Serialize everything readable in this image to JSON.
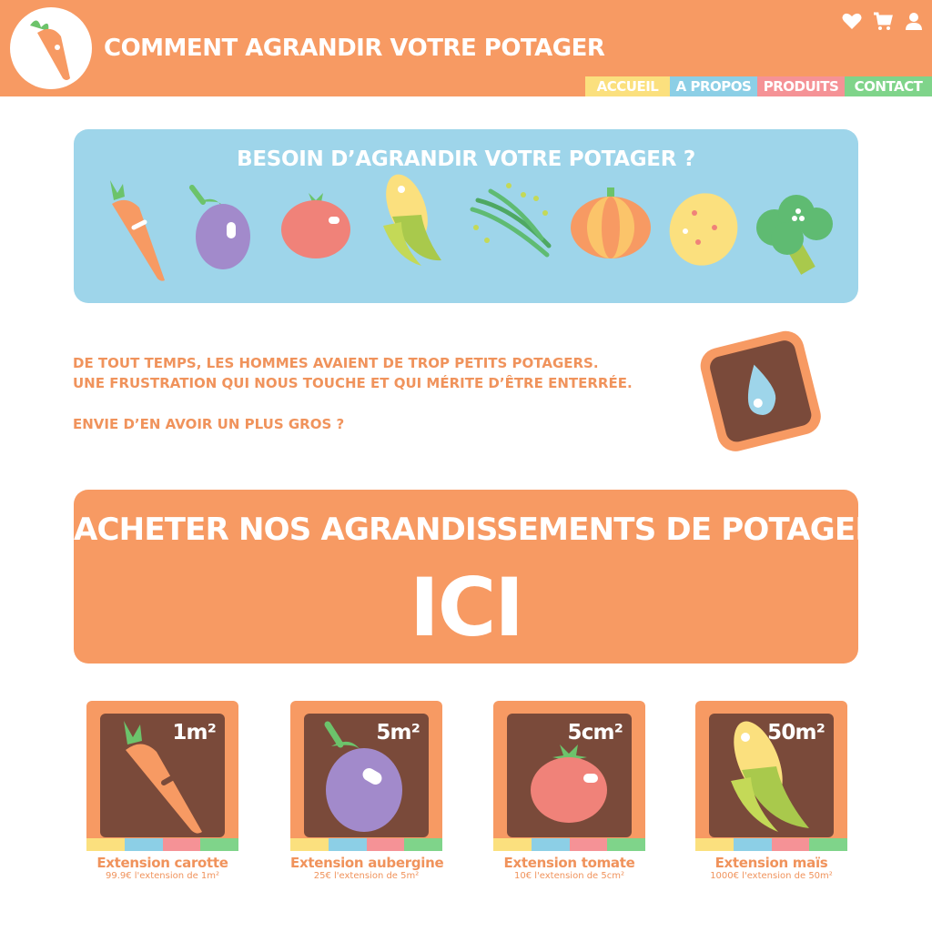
{
  "header": {
    "title": "COMMENT AGRANDIR VOTRE POTAGER",
    "logo_icon": "carrot-logo-icon",
    "icons": [
      "heart-icon",
      "cart-icon",
      "user-icon"
    ],
    "nav": [
      "ACCUEIL",
      "A PROPOS",
      "PRODUITS",
      "CONTACT"
    ]
  },
  "hero": {
    "title": "BESOIN D’AGRANDIR VOTRE POTAGER ?",
    "vegetables": [
      "carrot-icon",
      "eggplant-icon",
      "tomato-icon",
      "corn-icon",
      "green-beans-icon",
      "pumpkin-icon",
      "potato-icon",
      "broccoli-icon"
    ]
  },
  "intro": {
    "line1": "DE TOUT TEMPS, LES HOMMES AVAIENT DE TROP PETITS POTAGERS.",
    "line2": "UNE FRUSTRATION QUI NOUS TOUCHE ET QUI MÉRITE D’ÊTRE ENTERRÉE.",
    "line3": "ENVIE D’EN AVOIR UN PLUS GROS ?"
  },
  "cta": {
    "line": "ACHETER NOS AGRANDISSEMENTS DE POTAGERS",
    "big": "ICI"
  },
  "products": [
    {
      "size": "1m²",
      "name": "Extension carotte",
      "price": "99.9€ l'extension de 1m²",
      "icon": "carrot-icon"
    },
    {
      "size": "5m²",
      "name": "Extension aubergine",
      "price": "25€ l'extension de 5m²",
      "icon": "eggplant-icon"
    },
    {
      "size": "5cm²",
      "name": "Extension tomate",
      "price": "10€ l'extension de 5cm²",
      "icon": "tomato-icon"
    },
    {
      "size": "50m²",
      "name": "Extension maïs",
      "price": "1000€ l'extension de 50m²",
      "icon": "corn-icon"
    }
  ],
  "colors": {
    "orange": "#f79a63",
    "blue": "#9ed5ea",
    "yellow": "#fbe07e",
    "pink": "#f59296",
    "green": "#7fd48a",
    "brown": "#7a4a3a"
  }
}
